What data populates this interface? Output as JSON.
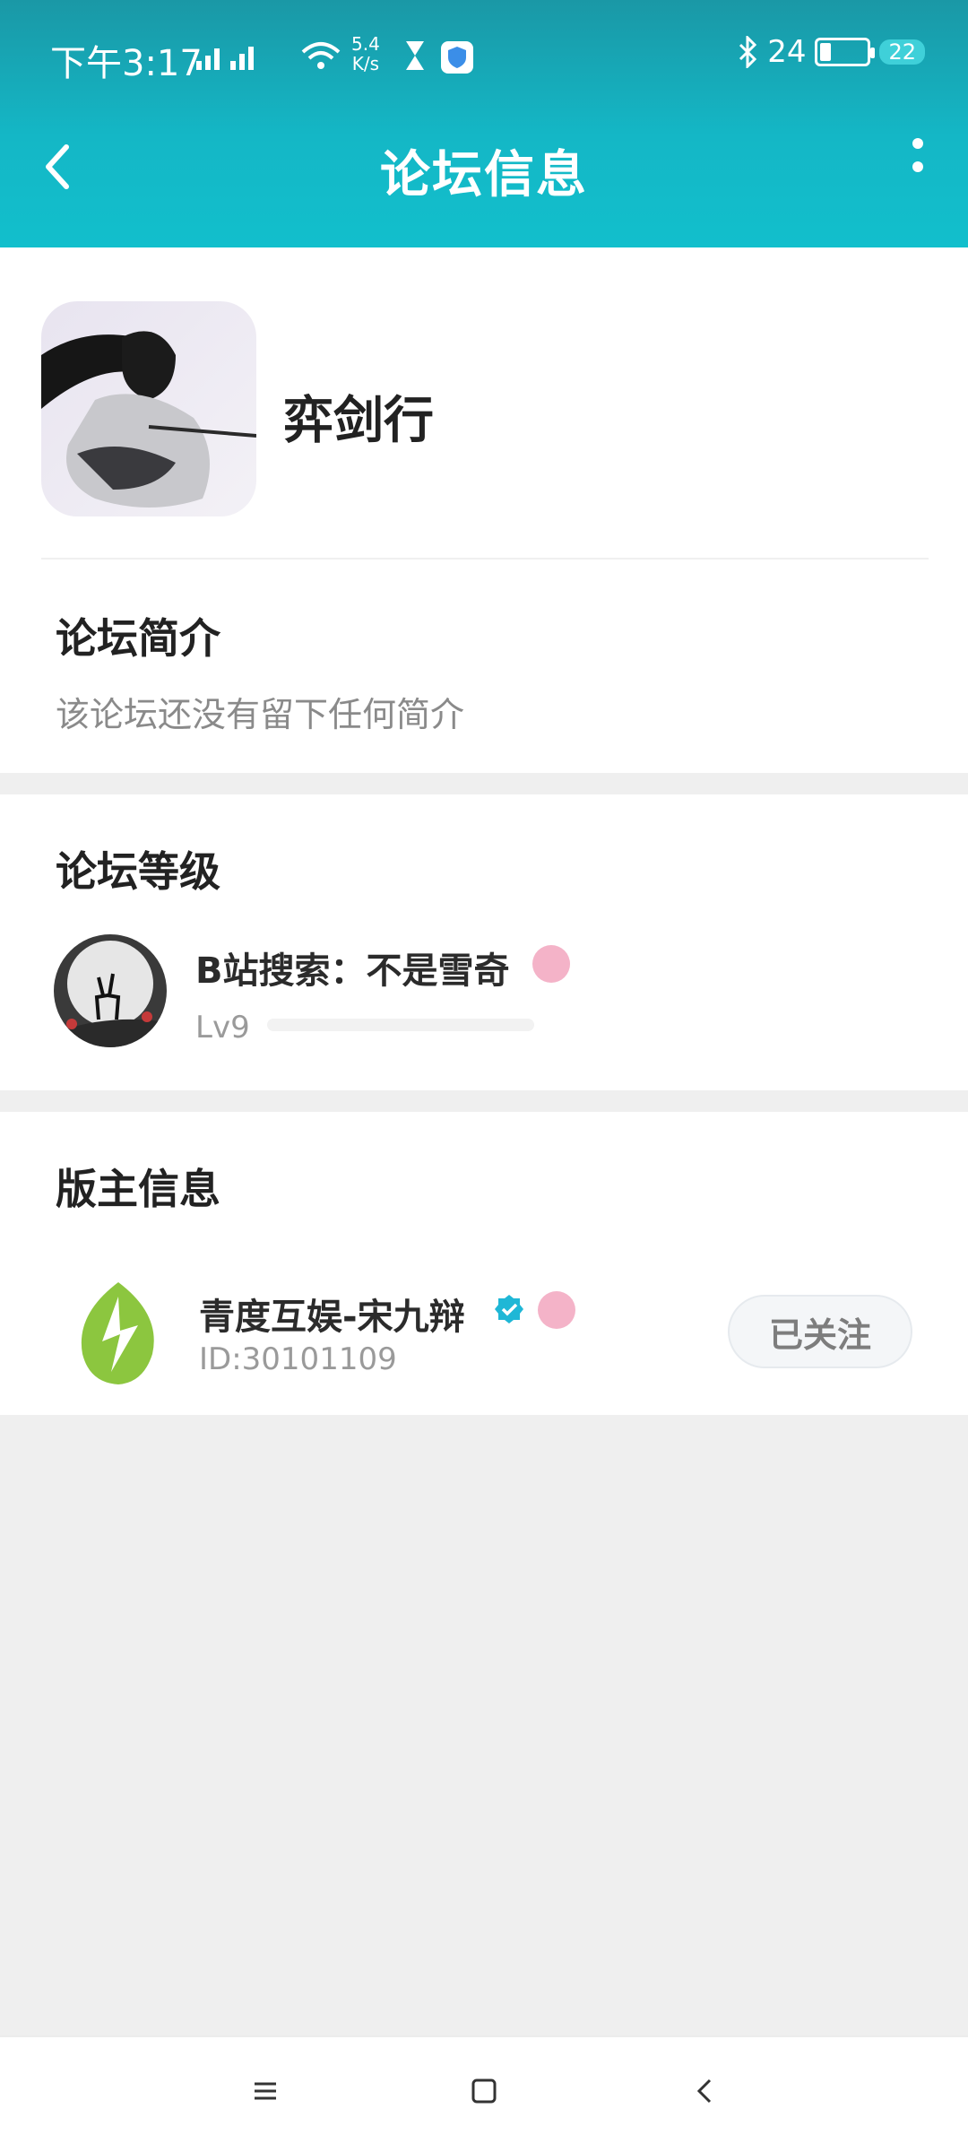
{
  "status_bar": {
    "time": "下午3:17",
    "net_speed_value": "5.4",
    "net_speed_unit": "K/s",
    "battery_text": "24",
    "notification_count": "22"
  },
  "header": {
    "title": "论坛信息"
  },
  "forum": {
    "name": "弈剑行",
    "intro_title": "论坛简介",
    "intro_text": "该论坛还没有留下任何简介"
  },
  "level": {
    "section_title": "论坛等级",
    "user_name": "B站搜索：不是雪奇",
    "level_label": "Lv9",
    "progress": 0.0
  },
  "moderator": {
    "section_title": "版主信息",
    "name": "青度互娱-宋九辩",
    "id": "ID:30101109",
    "follow_label": "已关注"
  },
  "colors": {
    "header_accent": "#12bfcc",
    "background": "#efefef",
    "verify_badge": "#1fb7d6",
    "pink_badge": "#f4b3c8"
  },
  "icons": [
    "back-arrow-icon",
    "more-vert-icon",
    "verified-icon",
    "fan-badge-icon",
    "menu-icon",
    "home-icon",
    "back-icon"
  ]
}
